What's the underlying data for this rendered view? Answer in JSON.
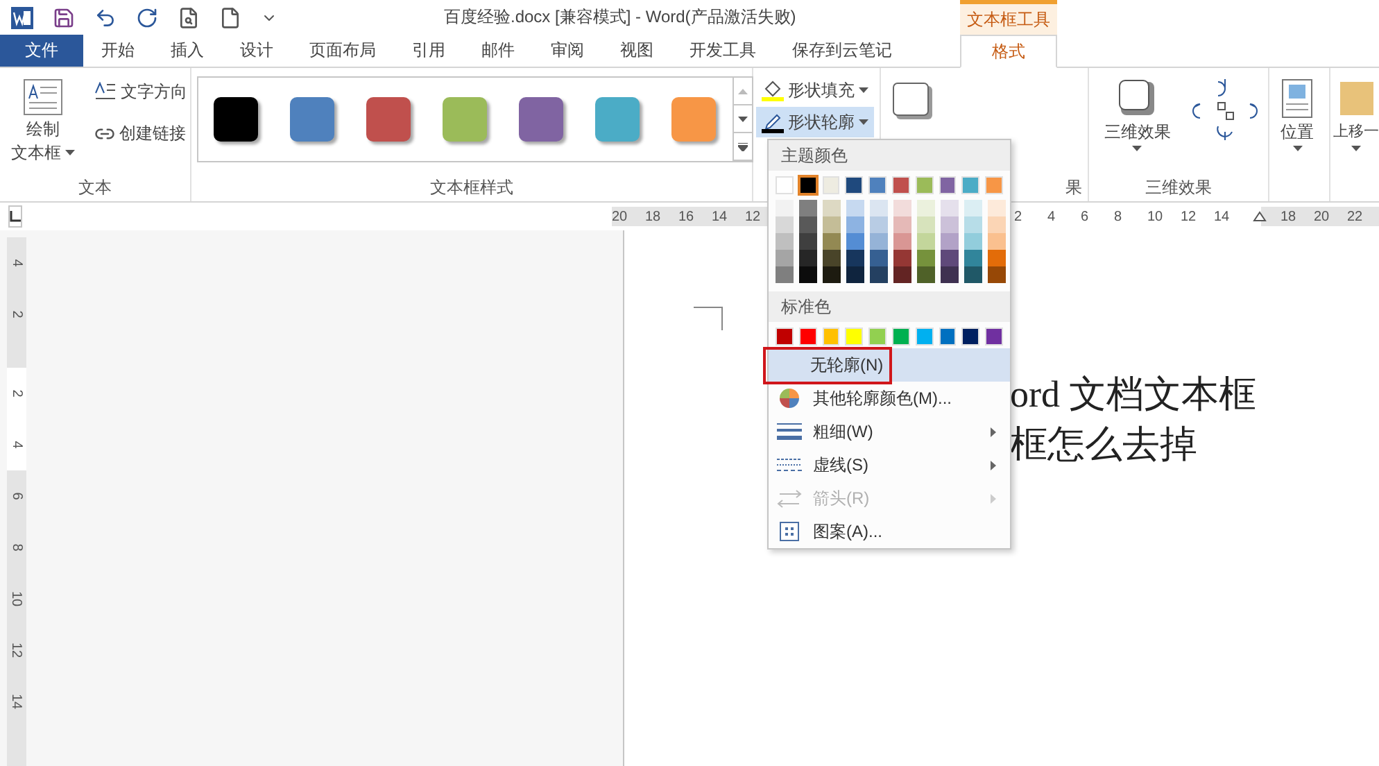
{
  "title_bar": {
    "title": "百度经验.docx [兼容模式] - Word(产品激活失败)",
    "context_tab": "文本框工具"
  },
  "tabs": [
    {
      "label": "文件",
      "kind": "file",
      "selected": false
    },
    {
      "label": "开始",
      "kind": "normal",
      "selected": false
    },
    {
      "label": "插入",
      "kind": "normal",
      "selected": false
    },
    {
      "label": "设计",
      "kind": "normal",
      "selected": false
    },
    {
      "label": "页面布局",
      "kind": "normal",
      "selected": false
    },
    {
      "label": "引用",
      "kind": "normal",
      "selected": false
    },
    {
      "label": "邮件",
      "kind": "normal",
      "selected": false
    },
    {
      "label": "审阅",
      "kind": "normal",
      "selected": false
    },
    {
      "label": "视图",
      "kind": "normal",
      "selected": false
    },
    {
      "label": "开发工具",
      "kind": "normal",
      "selected": false
    },
    {
      "label": "保存到云笔记",
      "kind": "normal",
      "selected": false
    },
    {
      "label": "格式",
      "kind": "context",
      "selected": true
    }
  ],
  "ribbon": {
    "text_group": {
      "label": "文本",
      "draw_button": [
        "绘制",
        "文本框"
      ],
      "text_direction": "文字方向",
      "create_link": "创建链接"
    },
    "styles_group": {
      "label": "文本框样式",
      "swatches": [
        {
          "color": "#000000"
        },
        {
          "color": "#4f81bd"
        },
        {
          "color": "#c0504d"
        },
        {
          "color": "#9bbb59"
        },
        {
          "color": "#8064a2"
        },
        {
          "color": "#4bacc6"
        },
        {
          "color": "#f79646"
        }
      ]
    },
    "shape_fill": {
      "label": "形状填充",
      "pressed": false
    },
    "shape_outline": {
      "label": "形状轮廓",
      "pressed": true
    },
    "effects_label": "果",
    "three_d": {
      "button": "三维效果",
      "label": "三维效果"
    },
    "position": "位置",
    "bring_forward": "上移一"
  },
  "ruler": {
    "left_numbers": [
      "20",
      "18",
      "16",
      "14",
      "12"
    ],
    "right_numbers": [
      "2",
      "4",
      "6",
      "8",
      "10",
      "12",
      "14"
    ],
    "far_numbers": [
      "18",
      "20",
      "22"
    ],
    "vertical_numbers": [
      "4",
      "2",
      "2",
      "4",
      "6",
      "8",
      "10",
      "12",
      "14"
    ]
  },
  "document": {
    "lines": [
      "ord  文档文本框",
      "框怎么去掉"
    ]
  },
  "outline_menu": {
    "theme_header": "主题颜色",
    "theme_colors": [
      {
        "color": "#ffffff",
        "selected": false,
        "shades": [
          {
            "color": "#f2f2f2"
          },
          {
            "color": "#d8d8d8"
          },
          {
            "color": "#bfbfbf"
          },
          {
            "color": "#a5a5a5"
          },
          {
            "color": "#7f7f7f"
          }
        ]
      },
      {
        "color": "#000000",
        "selected": true,
        "shades": [
          {
            "color": "#7f7f7f"
          },
          {
            "color": "#595959"
          },
          {
            "color": "#3f3f3f"
          },
          {
            "color": "#262626"
          },
          {
            "color": "#0c0c0c"
          }
        ]
      },
      {
        "color": "#eeece1",
        "selected": false,
        "shades": [
          {
            "color": "#ddd9c3"
          },
          {
            "color": "#c4bd97"
          },
          {
            "color": "#938953"
          },
          {
            "color": "#494429"
          },
          {
            "color": "#1d1b10"
          }
        ]
      },
      {
        "color": "#1f497d",
        "selected": false,
        "shades": [
          {
            "color": "#c6d9f0"
          },
          {
            "color": "#8db3e2"
          },
          {
            "color": "#548dd4"
          },
          {
            "color": "#17365d"
          },
          {
            "color": "#0f243e"
          }
        ]
      },
      {
        "color": "#4f81bd",
        "selected": false,
        "shades": [
          {
            "color": "#dbe5f1"
          },
          {
            "color": "#b8cce4"
          },
          {
            "color": "#95b3d7"
          },
          {
            "color": "#366092"
          },
          {
            "color": "#244061"
          }
        ]
      },
      {
        "color": "#c0504d",
        "selected": false,
        "shades": [
          {
            "color": "#f2dcdb"
          },
          {
            "color": "#e5b9b7"
          },
          {
            "color": "#d99694"
          },
          {
            "color": "#953734"
          },
          {
            "color": "#632423"
          }
        ]
      },
      {
        "color": "#9bbb59",
        "selected": false,
        "shades": [
          {
            "color": "#ebf1dd"
          },
          {
            "color": "#d7e3bc"
          },
          {
            "color": "#c3d69b"
          },
          {
            "color": "#76923c"
          },
          {
            "color": "#4f6128"
          }
        ]
      },
      {
        "color": "#8064a2",
        "selected": false,
        "shades": [
          {
            "color": "#e5e0ec"
          },
          {
            "color": "#ccc1d9"
          },
          {
            "color": "#b2a2c7"
          },
          {
            "color": "#5f497a"
          },
          {
            "color": "#3f3151"
          }
        ]
      },
      {
        "color": "#4bacc6",
        "selected": false,
        "shades": [
          {
            "color": "#dbeef3"
          },
          {
            "color": "#b7dde8"
          },
          {
            "color": "#92cddc"
          },
          {
            "color": "#31859b"
          },
          {
            "color": "#205867"
          }
        ]
      },
      {
        "color": "#f79646",
        "selected": false,
        "shades": [
          {
            "color": "#fdeada"
          },
          {
            "color": "#fbd5b5"
          },
          {
            "color": "#fac08f"
          },
          {
            "color": "#e36c09"
          },
          {
            "color": "#974806"
          }
        ]
      }
    ],
    "standard_header": "标准色",
    "standard_colors": [
      {
        "color": "#c00000"
      },
      {
        "color": "#ff0000"
      },
      {
        "color": "#ffc000"
      },
      {
        "color": "#ffff00"
      },
      {
        "color": "#92d050"
      },
      {
        "color": "#00b050"
      },
      {
        "color": "#00b0f0"
      },
      {
        "color": "#0070c0"
      },
      {
        "color": "#002060"
      },
      {
        "color": "#7030a0"
      }
    ],
    "items": [
      {
        "label": "无轮廓(N)",
        "kind": "plain",
        "highlighted": true,
        "outlined": true,
        "disabled": false,
        "submenu": false
      },
      {
        "label": "其他轮廓颜色(M)...",
        "kind": "palette",
        "highlighted": false,
        "outlined": false,
        "disabled": false,
        "submenu": false
      },
      {
        "label": "粗细(W)",
        "kind": "weight",
        "highlighted": false,
        "outlined": false,
        "disabled": false,
        "submenu": true
      },
      {
        "label": "虚线(S)",
        "kind": "dash",
        "highlighted": false,
        "outlined": false,
        "disabled": false,
        "submenu": true
      },
      {
        "label": "箭头(R)",
        "kind": "arrows",
        "highlighted": false,
        "outlined": false,
        "disabled": true,
        "submenu": true
      },
      {
        "label": "图案(A)...",
        "kind": "pattern",
        "highlighted": false,
        "outlined": false,
        "disabled": false,
        "submenu": false
      }
    ]
  }
}
